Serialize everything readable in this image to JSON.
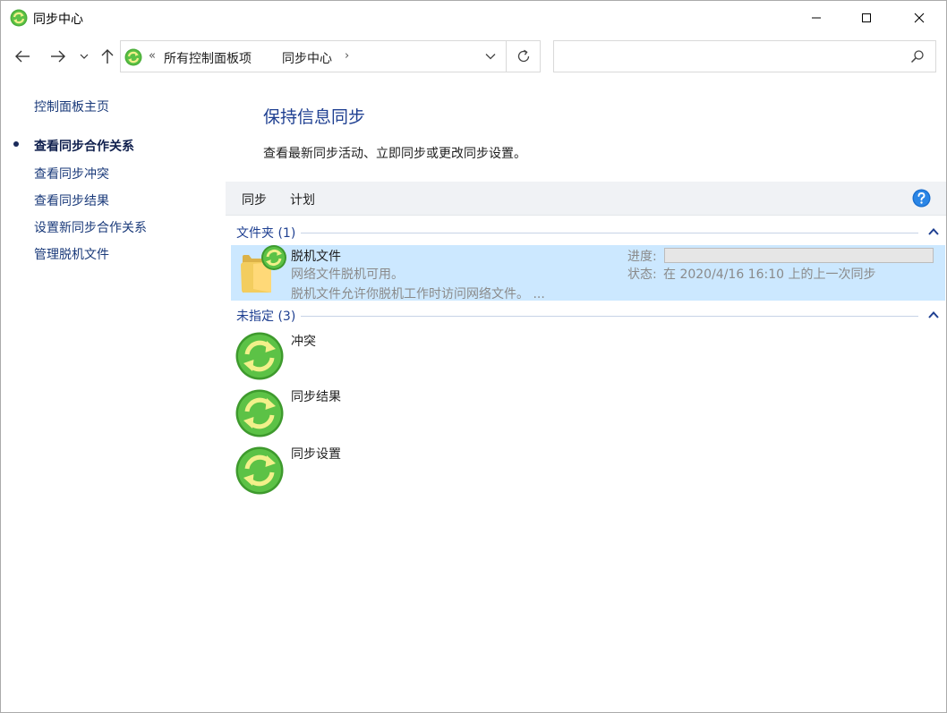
{
  "window": {
    "title": "同步中心",
    "app_icon": "sync-center-icon"
  },
  "nav": {
    "back_icon": "arrow-left-icon",
    "forward_icon": "arrow-right-icon",
    "recent_icon": "chevron-down-icon",
    "up_icon": "arrow-up-icon",
    "overflow": "«",
    "breadcrumb": [
      "所有控制面板项",
      "同步中心"
    ],
    "separator": "›",
    "search_placeholder": ""
  },
  "sidebar": {
    "home": "控制面板主页",
    "items": [
      {
        "label": "查看同步合作关系",
        "active": true
      },
      {
        "label": "查看同步冲突",
        "active": false
      },
      {
        "label": "查看同步结果",
        "active": false
      },
      {
        "label": "设置新同步合作关系",
        "active": false
      },
      {
        "label": "管理脱机文件",
        "active": false
      }
    ]
  },
  "main": {
    "heading": "保持信息同步",
    "description": "查看最新同步活动、立即同步或更改同步设置。",
    "toolbar": {
      "sync": "同步",
      "schedule": "计划",
      "help_icon": "help-icon"
    },
    "groups": [
      {
        "label": "文件夹 (1)",
        "items": [
          {
            "name": "脱机文件",
            "line2": "网络文件脱机可用。",
            "line3": "脱机文件允许你脱机工作时访问网络文件。 ...",
            "progress_label": "进度:",
            "progress": 0,
            "status_label": "状态:",
            "status": "在 2020/4/16 16:10 上的上一次同步",
            "icon": "folder-sync-icon",
            "selected": true
          }
        ]
      },
      {
        "label": "未指定 (3)",
        "items": [
          {
            "name": "冲突",
            "icon": "sync-icon"
          },
          {
            "name": "同步结果",
            "icon": "sync-icon"
          },
          {
            "name": "同步设置",
            "icon": "sync-icon"
          }
        ]
      }
    ]
  },
  "colors": {
    "accent_blue": "#1e3f91",
    "selection": "#cce8ff",
    "sync_green": "#4caf3a",
    "sync_arrows": "#f2f08a"
  }
}
